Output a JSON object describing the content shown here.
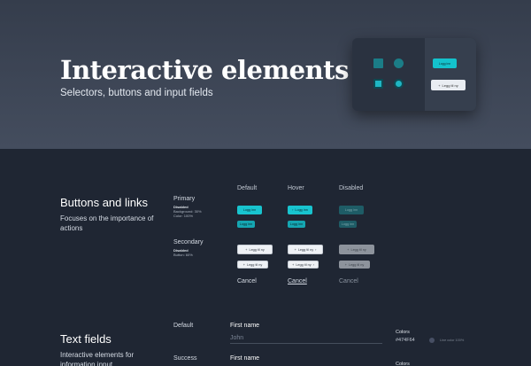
{
  "hero": {
    "title": "Interactive elements",
    "subtitle": "Selectors, buttons and input fields",
    "preview": {
      "primary_button": "Logg inn",
      "secondary_button": "Legg til ny",
      "plus_icon": "+"
    }
  },
  "buttons_section": {
    "title": "Buttons and links",
    "description": "Focuses on the importance of actions",
    "columns": [
      "Default",
      "Hover",
      "Disabled"
    ],
    "primary": {
      "label": "Primary",
      "sub_bold": "Disabled",
      "sub_lines": [
        "Background: 30%",
        "Color: 100%"
      ],
      "large_label": "Logg inn",
      "small_label": "Logg inn"
    },
    "secondary": {
      "label": "Secondary",
      "sub_bold": "Disabled",
      "sub_lines": [
        "Button: 60%"
      ],
      "large_label": "Legg til ny",
      "small_label": "Legg til ny"
    },
    "link_label": "Cancel"
  },
  "text_fields": {
    "title": "Text fields",
    "description": "Interactive elements for information input",
    "states": {
      "default": "Default",
      "success": "Success"
    },
    "field_label": "First name",
    "default_value": "John",
    "colors_label": "Colors",
    "colors_hex": "#474F64",
    "swatch_note": "Line color 100%",
    "accent": "#18c4cf"
  }
}
